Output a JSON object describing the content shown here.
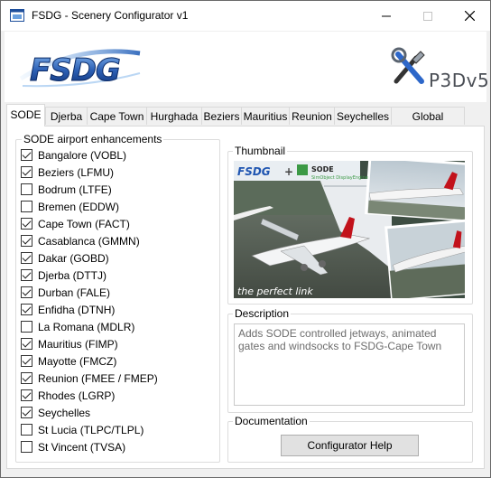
{
  "window": {
    "title": "FSDG - Scenery Configurator v1"
  },
  "banner": {
    "logo_text": "FSDG",
    "sim_label": "P3Dv5"
  },
  "tabs": [
    "SODE",
    "Djerba",
    "Cape Town",
    "Hurghada",
    "Beziers",
    "Mauritius",
    "Reunion",
    "Seychelles",
    "Global Settings"
  ],
  "active_tab": "SODE",
  "airports": {
    "group_label": "SODE airport enhancements",
    "items": [
      {
        "label": "Bangalore (VOBL)",
        "checked": true
      },
      {
        "label": "Beziers (LFMU)",
        "checked": true
      },
      {
        "label": "Bodrum (LTFE)",
        "checked": false
      },
      {
        "label": "Bremen (EDDW)",
        "checked": false
      },
      {
        "label": "Cape Town (FACT)",
        "checked": true
      },
      {
        "label": "Casablanca (GMMN)",
        "checked": true
      },
      {
        "label": "Dakar (GOBD)",
        "checked": true
      },
      {
        "label": "Djerba (DTTJ)",
        "checked": true
      },
      {
        "label": "Durban (FALE)",
        "checked": true
      },
      {
        "label": "Enfidha (DTNH)",
        "checked": true
      },
      {
        "label": "La Romana (MDLR)",
        "checked": false
      },
      {
        "label": "Mauritius (FIMP)",
        "checked": true
      },
      {
        "label": "Mayotte (FMCZ)",
        "checked": true
      },
      {
        "label": "Reunion (FMEE / FMEP)",
        "checked": true
      },
      {
        "label": "Rhodes (LGRP)",
        "checked": true
      },
      {
        "label": "Seychelles",
        "checked": true
      },
      {
        "label": "St Lucia (TLPC/TLPL)",
        "checked": false
      },
      {
        "label": "St Vincent (TVSA)",
        "checked": false
      }
    ]
  },
  "thumbnail": {
    "group_label": "Thumbnail",
    "logo_text": "FSDG",
    "plus": "+",
    "sode_title": "SODE",
    "sode_subtitle": "SimObject DisplayEngine",
    "caption": "the perfect link"
  },
  "description": {
    "group_label": "Description",
    "text": "Adds SODE controlled jetways, animated gates and windsocks to FSDG-Cape Town"
  },
  "documentation": {
    "group_label": "Documentation",
    "button_label": "Configurator Help"
  }
}
